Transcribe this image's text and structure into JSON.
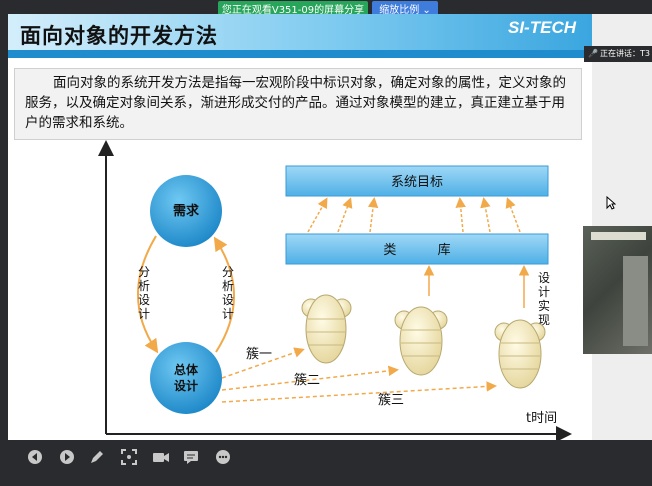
{
  "share": {
    "text": "您正在观看V351-09的屏幕分享",
    "zoom_label": "缩放比例",
    "zoom_chevron": "chevron-down-icon"
  },
  "slide": {
    "title": "面向对象的开发方法",
    "logo": "SI-TECH",
    "intro": "面向对象的系统开发方法是指每一宏观阶段中标识对象，确定对象的属性，定义对象的服务，以及确定对象间关系，渐进形成交付的产品。通过对象模型的建立，真正建立基于用户的需求和系统。"
  },
  "diagram": {
    "top_box": "系统目标",
    "class_box": "类          库",
    "circle_top": "需求",
    "circle_bottom_1": "总体",
    "circle_bottom_2": "设计",
    "left_label": [
      "分",
      "析",
      "设",
      "计"
    ],
    "right_label": [
      "分",
      "析",
      "设",
      "计"
    ],
    "impl_label": [
      "设",
      "计",
      "实",
      "现"
    ],
    "cluster1": "簇一",
    "cluster2": "簇二",
    "cluster3": "簇三",
    "time_axis": "t时间"
  },
  "speaker": {
    "text": "正在讲话：T3"
  },
  "colors": {
    "accent_blue": "#1f8cce",
    "circle_blue": "#2f9fd8",
    "arrow_orange": "#f2a94a",
    "share_green": "#27a55a",
    "zoom_blue": "#3f7ddd"
  },
  "toolbar": {
    "icons": [
      "prev-icon",
      "next-icon",
      "pen-icon",
      "fullscreen-icon",
      "camera-icon",
      "chat-icon",
      "more-icon"
    ]
  }
}
